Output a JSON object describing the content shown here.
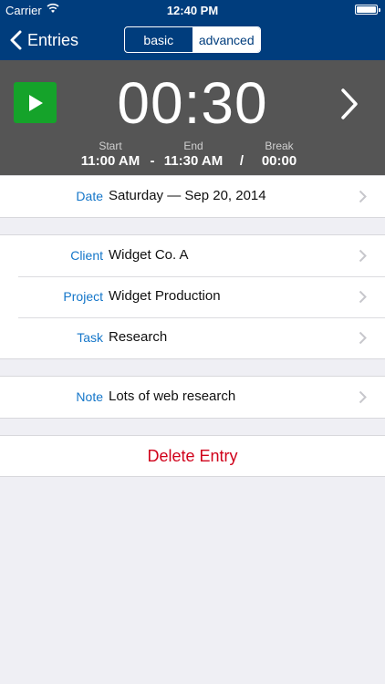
{
  "status_bar": {
    "carrier": "Carrier",
    "time": "12:40 PM"
  },
  "navbar": {
    "back_label": "Entries",
    "segments": {
      "basic": "basic",
      "advanced": "advanced"
    },
    "selected_segment": "advanced",
    "bar_color": "#003d7d"
  },
  "timer": {
    "elapsed": "00:30",
    "start_label": "Start",
    "start_value": "11:00 AM",
    "separator_1": "-",
    "end_label": "End",
    "end_value": "11:30 AM",
    "separator_2": "/",
    "break_label": "Break",
    "break_value": "00:00",
    "play_color": "#15a32a"
  },
  "date_row": {
    "label": "Date",
    "value": "Saturday — Sep 20, 2014"
  },
  "details": [
    {
      "label": "Client",
      "value": "Widget Co. A"
    },
    {
      "label": "Project",
      "value": "Widget Production"
    },
    {
      "label": "Task",
      "value": "Research"
    }
  ],
  "note_row": {
    "label": "Note",
    "value": "Lots of web research"
  },
  "delete_label": "Delete Entry",
  "colors": {
    "label_blue": "#1476c9",
    "delete_red": "#d0021b"
  }
}
